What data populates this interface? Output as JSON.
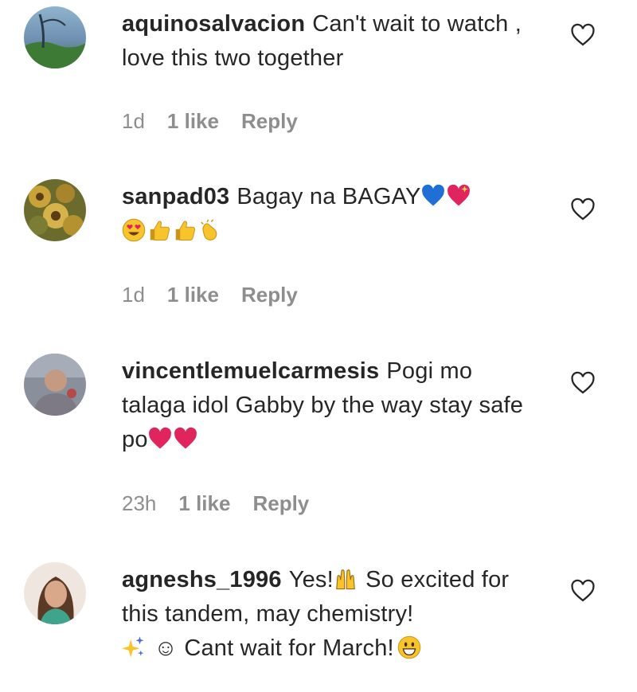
{
  "comments": [
    {
      "username": "aquinosalvacion",
      "text": "Can't wait to watch , love this two together",
      "age": "1d",
      "likes": "1 like",
      "reply": "Reply"
    },
    {
      "username": "sanpad03",
      "text": "Bagay na BAGAY",
      "emojis": [
        "blue-heart",
        "sparkling-heart",
        "heart-eyes",
        "thumbs-up",
        "thumbs-up",
        "clapping-hands"
      ],
      "age": "1d",
      "likes": "1 like",
      "reply": "Reply"
    },
    {
      "username": "vincentlemuelcarmesis",
      "text": "Pogi mo talaga idol Gabby by the way stay safe po",
      "emojis": [
        "red-heart",
        "red-heart"
      ],
      "age": "23h",
      "likes": "1 like",
      "reply": "Reply"
    },
    {
      "username": "agneshs_1996",
      "text_1": "Yes!",
      "text_2": "So excited for this tandem, may chemistry!",
      "text_3": "☺ Cant wait for March!",
      "emojis": [
        "raising-hands",
        "sparkles",
        "grinning-face"
      ],
      "age": "",
      "likes": "",
      "reply": ""
    }
  ],
  "colors": {
    "text": "#262626",
    "meta": "#8e8e8e",
    "heart_red": "#e0245e",
    "blue_heart": "#1f6fd6",
    "emoji_yellow": "#f7c52b"
  }
}
